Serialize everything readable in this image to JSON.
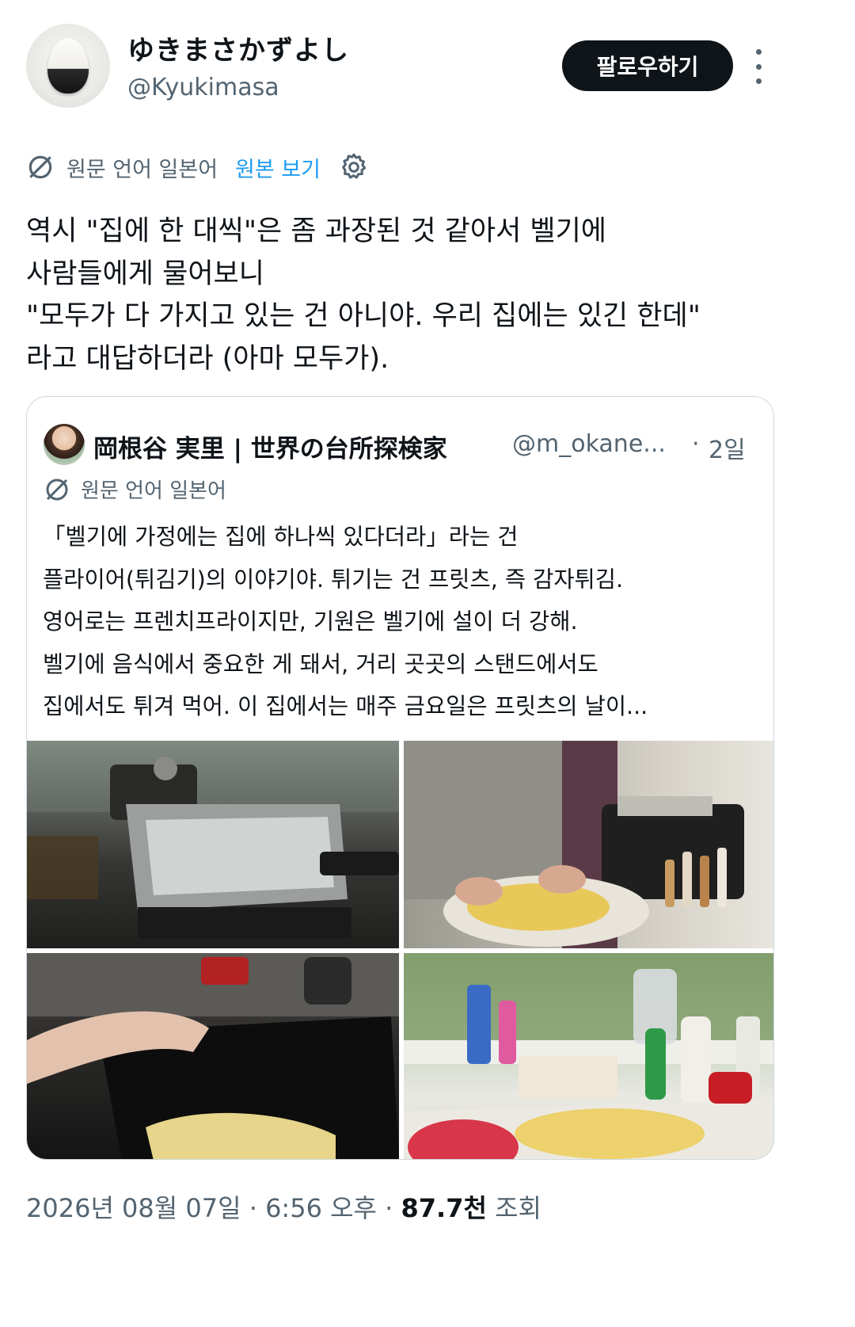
{
  "author": {
    "display_name": "ゆきまさかずよし",
    "handle": "@Kyukimasa"
  },
  "actions": {
    "follow_label": "팔로우하기"
  },
  "translation": {
    "source_language": "원문 언어 일본어",
    "view_original": "원본 보기"
  },
  "post": {
    "text": "역시 \"집에 한 대씩\"은 좀 과장된 것 같아서 벨기에\n사람들에게 물어보니\n\"모두가 다 가지고 있는 건 아니야. 우리 집에는 있긴 한데\"\n라고 대답하더라 (아마 모두가)."
  },
  "quote": {
    "display_name": "岡根谷 実里 | 世界の台所探検家",
    "handle": "@m_okane...",
    "separator": "·",
    "time": "2일",
    "source_language": "원문 언어 일본어",
    "text": "「벨기에 가정에는 집에 하나씩 있다더라」라는 건\n플라이어(튀김기)의 이야기야. 튀기는 건 프릿츠, 즉 감자튀김.\n영어로는 프렌치프라이지만, 기원은 벨기에 설이 더 강해.\n벨기에 음식에서 중요한 게 돼서, 거리 곳곳의 스탠드에서도\n집에서도 튀겨 먹어. 이 집에서는 매주 금요일은 프릿츠의 날이..."
  },
  "meta": {
    "date": "2026년 08월 07일",
    "sep1": "·",
    "time": "6:56 오후",
    "sep2": "·",
    "views": "87.7천",
    "views_label": "조회"
  }
}
